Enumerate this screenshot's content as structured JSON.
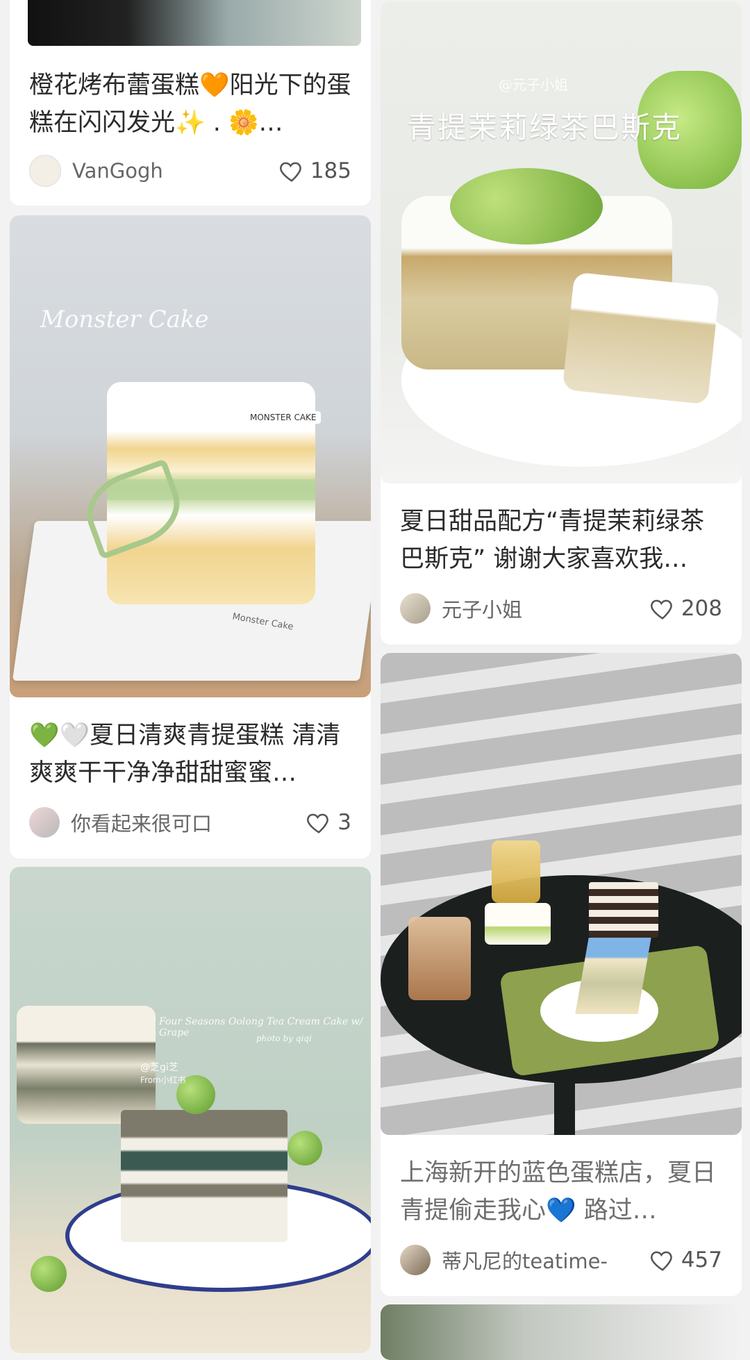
{
  "cards": [
    {
      "title": "橙花烤布蕾蛋糕🧡阳光下的蛋糕在闪闪发光✨ . 🌼…",
      "author": "VanGogh",
      "likes": "185"
    },
    {
      "title": "夏日甜品配方“青提茉莉绿茶巴斯克” 谢谢大家喜欢我…",
      "author": "元子小姐",
      "likes": "208",
      "image_text": [
        "@元子小姐",
        "青提茉莉绿茶巴斯克"
      ]
    },
    {
      "title": "💚🤍夏日清爽青提蛋糕 清清爽爽干干净净甜甜蜜蜜…",
      "author": "你看起来很可口",
      "likes": "3",
      "image_text": [
        "Monster Cake",
        "MONSTER CAKE",
        "Monster Cake"
      ]
    },
    {
      "title": "上海新开的蓝色蛋糕店，夏日青提偷走我心💙 路过…",
      "author": "蒂凡尼的teatime-",
      "likes": "457"
    },
    {
      "image_text": [
        "Four Seasons Oolong Tea Cream Cake w/ Grape",
        "photo by qiqi",
        "@芝gi芝",
        "From小红书"
      ]
    }
  ],
  "icons": {
    "like": "heart-outline-icon"
  },
  "colors": {
    "background": "#f2f2f2",
    "card": "#ffffff",
    "text": "#2b2b2b",
    "meta": "#666666"
  }
}
